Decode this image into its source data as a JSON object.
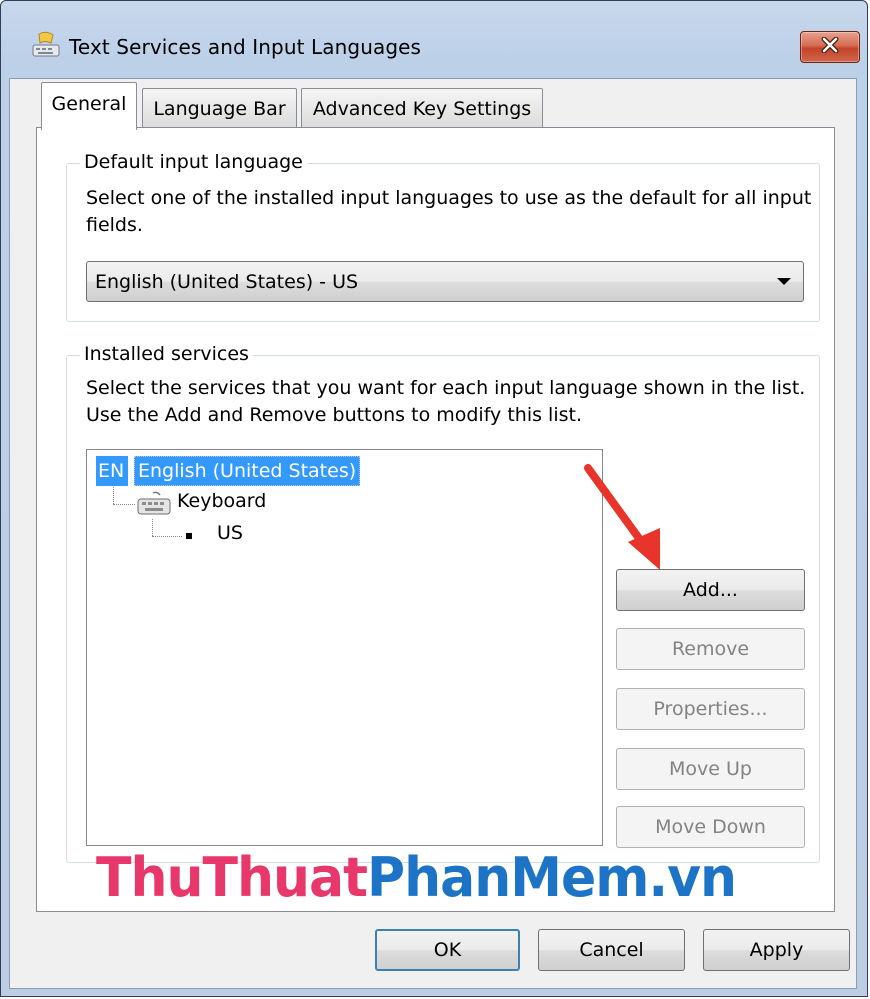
{
  "window": {
    "title": "Text Services and Input Languages",
    "icon": "keyboard-language-icon",
    "close_icon": "close-icon"
  },
  "tabs": [
    {
      "label": "General",
      "active": true
    },
    {
      "label": "Language Bar",
      "active": false
    },
    {
      "label": "Advanced Key Settings",
      "active": false
    }
  ],
  "default_input": {
    "group_title": "Default input language",
    "description_line1": "Select one of the installed input languages to use as the default for all input",
    "description_line2": "fields.",
    "selected_value": "English (United States) - US"
  },
  "installed_services": {
    "group_title": "Installed services",
    "description_line1": "Select the services that you want for each input language shown in the list.",
    "description_line2": "Use the Add and Remove buttons to modify this list.",
    "tree": {
      "language_code": "EN",
      "language_name": "English (United States)",
      "category": "Keyboard",
      "category_icon": "keyboard-icon",
      "service": "US"
    },
    "buttons": {
      "add": "Add...",
      "remove": "Remove",
      "properties": "Properties...",
      "move_up": "Move Up",
      "move_down": "Move Down"
    }
  },
  "footer": {
    "ok": "OK",
    "cancel": "Cancel",
    "apply": "Apply"
  },
  "watermark": {
    "part1": "ThuThuat",
    "part2": "PhanMem.vn"
  },
  "annotation": {
    "icon": "red-arrow-icon",
    "color": "#e8342a"
  },
  "colors": {
    "selection": "#3399ff",
    "watermark_red": "#e8386b",
    "watermark_blue": "#1d74c7"
  }
}
